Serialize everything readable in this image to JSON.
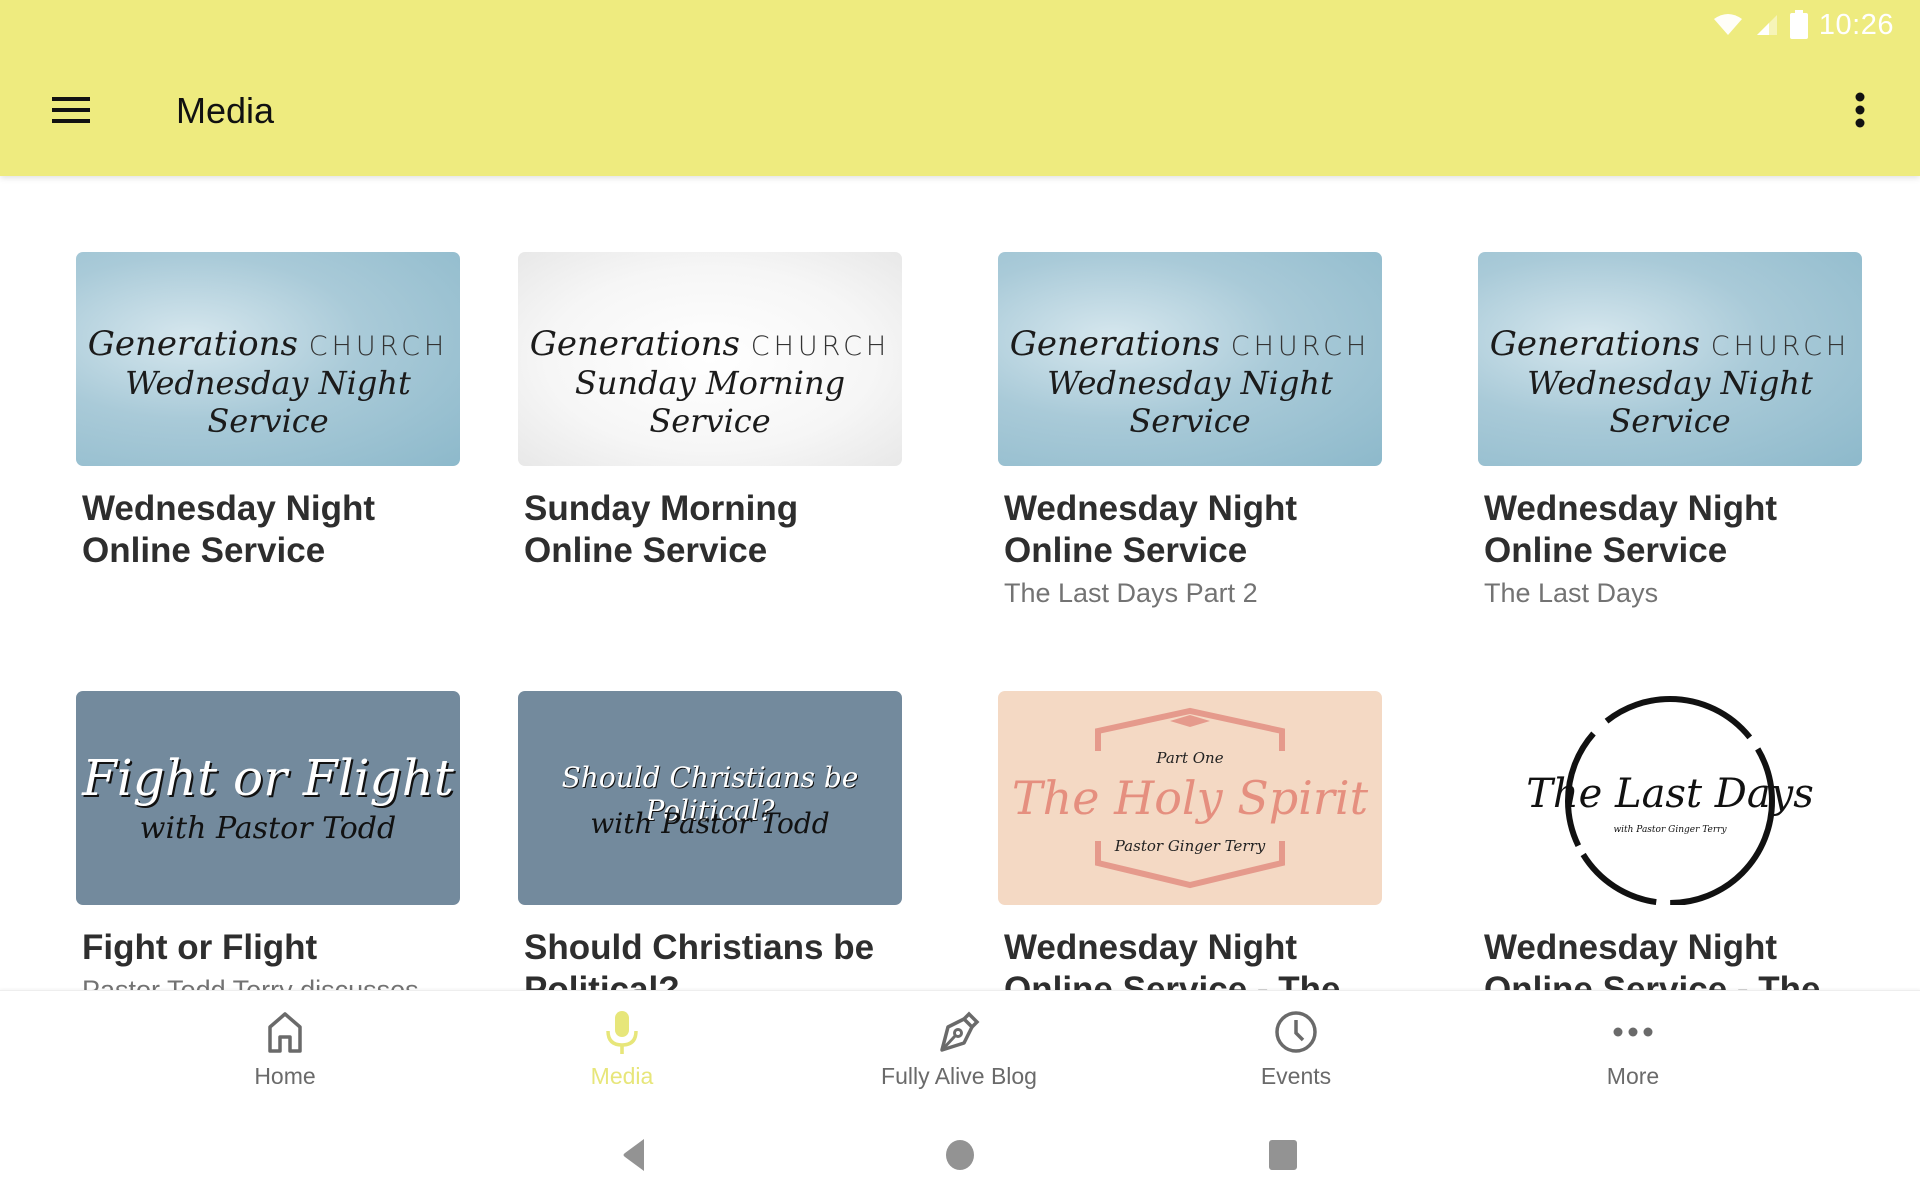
{
  "status_bar": {
    "time": "10:26",
    "icons": [
      "wifi-icon",
      "cell-signal-icon",
      "battery-icon"
    ]
  },
  "app_bar": {
    "title": "Media",
    "menu_icon": "hamburger-menu-icon",
    "overflow_icon": "more-vertical-icon"
  },
  "colors": {
    "app_bar": "#eeeb7f",
    "active_tab": "#e7e67a",
    "inactive_tab": "#6a6a6a",
    "card_title": "#2e2e2e",
    "card_subtitle": "#737373"
  },
  "media_items": [
    {
      "title": "Wednesday Night Online Service",
      "subtitle": "",
      "thumbnail": {
        "style": "wednesday",
        "line1_script": "Generations",
        "line1_caps": "CHURCH",
        "line2": "Wednesday Night Service"
      }
    },
    {
      "title": "Sunday Morning Online Service",
      "subtitle": "",
      "thumbnail": {
        "style": "sunday",
        "line1_script": "Generations",
        "line1_caps": "CHURCH",
        "line2": "Sunday Morning Service"
      }
    },
    {
      "title": "Wednesday Night Online Service",
      "subtitle": "The Last Days Part 2",
      "thumbnail": {
        "style": "wednesday",
        "line1_script": "Generations",
        "line1_caps": "CHURCH",
        "line2": "Wednesday Night Service"
      }
    },
    {
      "title": "Wednesday Night Online Service",
      "subtitle": "The Last Days",
      "thumbnail": {
        "style": "wednesday",
        "line1_script": "Generations",
        "line1_caps": "CHURCH",
        "line2": "Wednesday Night Service"
      }
    },
    {
      "title": "Fight or Flight",
      "subtitle": "Pastor Todd Terry discusses",
      "thumbnail": {
        "style": "slate",
        "line1": "Fight or Flight",
        "line2": "with Pastor Todd"
      }
    },
    {
      "title": "Should Christians be Political?",
      "subtitle": "",
      "thumbnail": {
        "style": "slate",
        "line1": "Should Christians be Political?",
        "line2": "with Pastor Todd"
      }
    },
    {
      "title": "Wednesday Night Online Service - The",
      "subtitle": "",
      "thumbnail": {
        "style": "holy-spirit",
        "line1": "Part One",
        "line2": "The Holy Spirit",
        "line3": "Pastor Ginger Terry"
      }
    },
    {
      "title": "Wednesday Night Online Service - The",
      "subtitle": "",
      "thumbnail": {
        "style": "last-days",
        "line1": "The Last Days",
        "line2": "with Pastor Ginger Terry"
      }
    }
  ],
  "bottom_nav": {
    "active": "Media",
    "items": [
      {
        "label": "Home",
        "icon": "home-icon"
      },
      {
        "label": "Media",
        "icon": "microphone-icon"
      },
      {
        "label": "Fully Alive Blog",
        "icon": "pen-nib-icon"
      },
      {
        "label": "Events",
        "icon": "clock-icon"
      },
      {
        "label": "More",
        "icon": "more-horizontal-icon"
      }
    ]
  },
  "system_nav": {
    "buttons": [
      "back-icon",
      "home-circle-icon",
      "recents-icon"
    ]
  }
}
